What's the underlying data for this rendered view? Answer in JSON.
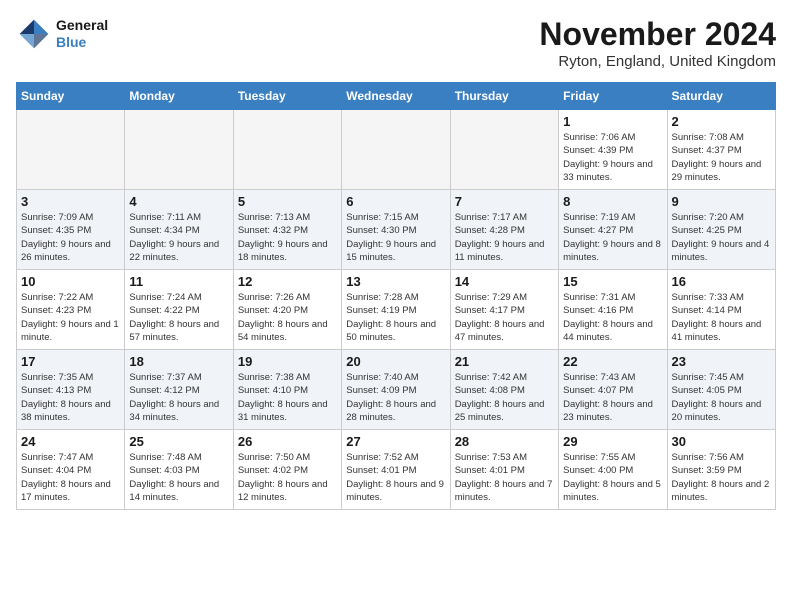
{
  "header": {
    "logo_line1": "General",
    "logo_line2": "Blue",
    "month": "November 2024",
    "location": "Ryton, England, United Kingdom"
  },
  "days_of_week": [
    "Sunday",
    "Monday",
    "Tuesday",
    "Wednesday",
    "Thursday",
    "Friday",
    "Saturday"
  ],
  "weeks": [
    [
      {
        "day": "",
        "info": ""
      },
      {
        "day": "",
        "info": ""
      },
      {
        "day": "",
        "info": ""
      },
      {
        "day": "",
        "info": ""
      },
      {
        "day": "",
        "info": ""
      },
      {
        "day": "1",
        "info": "Sunrise: 7:06 AM\nSunset: 4:39 PM\nDaylight: 9 hours and 33 minutes."
      },
      {
        "day": "2",
        "info": "Sunrise: 7:08 AM\nSunset: 4:37 PM\nDaylight: 9 hours and 29 minutes."
      }
    ],
    [
      {
        "day": "3",
        "info": "Sunrise: 7:09 AM\nSunset: 4:35 PM\nDaylight: 9 hours and 26 minutes."
      },
      {
        "day": "4",
        "info": "Sunrise: 7:11 AM\nSunset: 4:34 PM\nDaylight: 9 hours and 22 minutes."
      },
      {
        "day": "5",
        "info": "Sunrise: 7:13 AM\nSunset: 4:32 PM\nDaylight: 9 hours and 18 minutes."
      },
      {
        "day": "6",
        "info": "Sunrise: 7:15 AM\nSunset: 4:30 PM\nDaylight: 9 hours and 15 minutes."
      },
      {
        "day": "7",
        "info": "Sunrise: 7:17 AM\nSunset: 4:28 PM\nDaylight: 9 hours and 11 minutes."
      },
      {
        "day": "8",
        "info": "Sunrise: 7:19 AM\nSunset: 4:27 PM\nDaylight: 9 hours and 8 minutes."
      },
      {
        "day": "9",
        "info": "Sunrise: 7:20 AM\nSunset: 4:25 PM\nDaylight: 9 hours and 4 minutes."
      }
    ],
    [
      {
        "day": "10",
        "info": "Sunrise: 7:22 AM\nSunset: 4:23 PM\nDaylight: 9 hours and 1 minute."
      },
      {
        "day": "11",
        "info": "Sunrise: 7:24 AM\nSunset: 4:22 PM\nDaylight: 8 hours and 57 minutes."
      },
      {
        "day": "12",
        "info": "Sunrise: 7:26 AM\nSunset: 4:20 PM\nDaylight: 8 hours and 54 minutes."
      },
      {
        "day": "13",
        "info": "Sunrise: 7:28 AM\nSunset: 4:19 PM\nDaylight: 8 hours and 50 minutes."
      },
      {
        "day": "14",
        "info": "Sunrise: 7:29 AM\nSunset: 4:17 PM\nDaylight: 8 hours and 47 minutes."
      },
      {
        "day": "15",
        "info": "Sunrise: 7:31 AM\nSunset: 4:16 PM\nDaylight: 8 hours and 44 minutes."
      },
      {
        "day": "16",
        "info": "Sunrise: 7:33 AM\nSunset: 4:14 PM\nDaylight: 8 hours and 41 minutes."
      }
    ],
    [
      {
        "day": "17",
        "info": "Sunrise: 7:35 AM\nSunset: 4:13 PM\nDaylight: 8 hours and 38 minutes."
      },
      {
        "day": "18",
        "info": "Sunrise: 7:37 AM\nSunset: 4:12 PM\nDaylight: 8 hours and 34 minutes."
      },
      {
        "day": "19",
        "info": "Sunrise: 7:38 AM\nSunset: 4:10 PM\nDaylight: 8 hours and 31 minutes."
      },
      {
        "day": "20",
        "info": "Sunrise: 7:40 AM\nSunset: 4:09 PM\nDaylight: 8 hours and 28 minutes."
      },
      {
        "day": "21",
        "info": "Sunrise: 7:42 AM\nSunset: 4:08 PM\nDaylight: 8 hours and 25 minutes."
      },
      {
        "day": "22",
        "info": "Sunrise: 7:43 AM\nSunset: 4:07 PM\nDaylight: 8 hours and 23 minutes."
      },
      {
        "day": "23",
        "info": "Sunrise: 7:45 AM\nSunset: 4:05 PM\nDaylight: 8 hours and 20 minutes."
      }
    ],
    [
      {
        "day": "24",
        "info": "Sunrise: 7:47 AM\nSunset: 4:04 PM\nDaylight: 8 hours and 17 minutes."
      },
      {
        "day": "25",
        "info": "Sunrise: 7:48 AM\nSunset: 4:03 PM\nDaylight: 8 hours and 14 minutes."
      },
      {
        "day": "26",
        "info": "Sunrise: 7:50 AM\nSunset: 4:02 PM\nDaylight: 8 hours and 12 minutes."
      },
      {
        "day": "27",
        "info": "Sunrise: 7:52 AM\nSunset: 4:01 PM\nDaylight: 8 hours and 9 minutes."
      },
      {
        "day": "28",
        "info": "Sunrise: 7:53 AM\nSunset: 4:01 PM\nDaylight: 8 hours and 7 minutes."
      },
      {
        "day": "29",
        "info": "Sunrise: 7:55 AM\nSunset: 4:00 PM\nDaylight: 8 hours and 5 minutes."
      },
      {
        "day": "30",
        "info": "Sunrise: 7:56 AM\nSunset: 3:59 PM\nDaylight: 8 hours and 2 minutes."
      }
    ]
  ]
}
